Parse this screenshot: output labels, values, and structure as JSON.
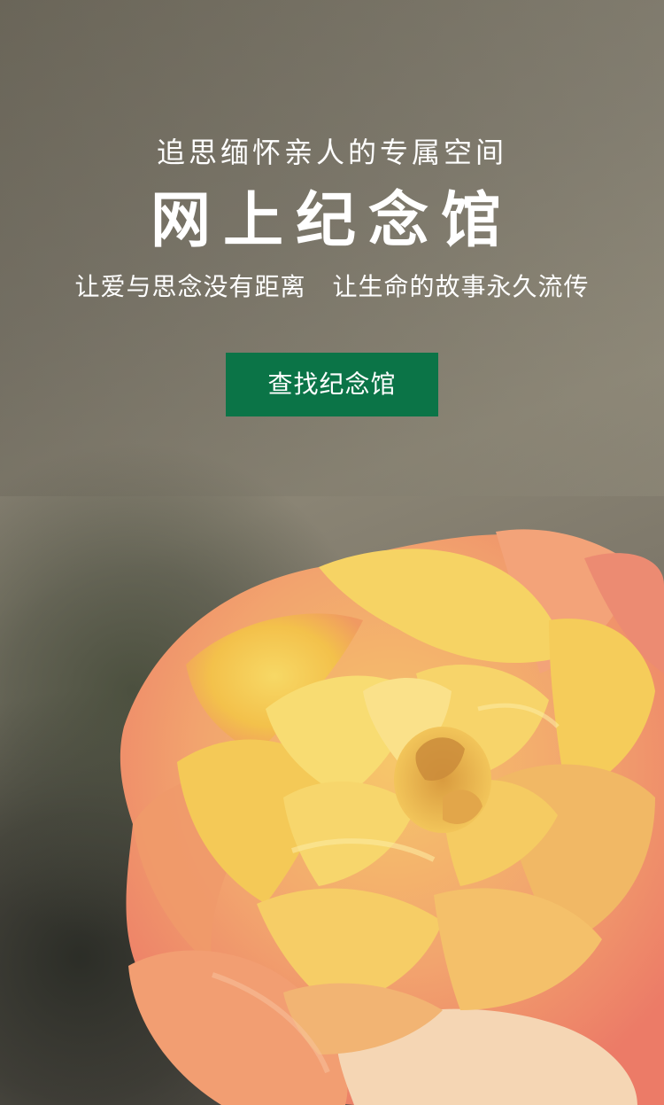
{
  "hero": {
    "subtitle": "追思缅怀亲人的专属空间",
    "title": "网上纪念馆",
    "slogan_left": "让爱与思念没有距离",
    "slogan_right": "让生命的故事永久流传"
  },
  "cta": {
    "label": "查找纪念馆"
  },
  "colors": {
    "button_bg": "#0b7447",
    "text": "#ffffff",
    "rose_yellow": "#f6cf52",
    "rose_pink": "#f08a6b"
  },
  "image": {
    "description_icon": "rose-photo"
  }
}
